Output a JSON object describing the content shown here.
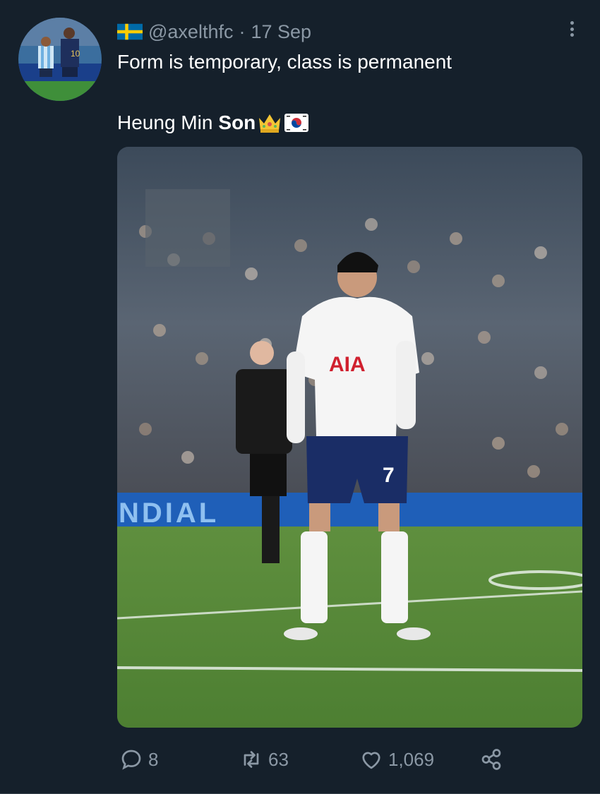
{
  "tweet": {
    "handle": "@axelthfc",
    "separator": "·",
    "date": "17 Sep",
    "line1": "Form is temporary, class is permanent",
    "line2_prefix": "Heung Min",
    "line2_bold": "Son",
    "emojis": [
      "crown-emoji",
      "south-korea-flag-emoji"
    ],
    "author_flag": "sweden-flag-emoji"
  },
  "media": {
    "jersey_sponsor": "AIA",
    "shirt_number": "7",
    "board_text": "NDIAL"
  },
  "actions": {
    "reply_count": "8",
    "retweet_count": "63",
    "like_count": "1,069"
  },
  "colors": {
    "background": "#15202b",
    "secondary_text": "#8b98a5"
  }
}
